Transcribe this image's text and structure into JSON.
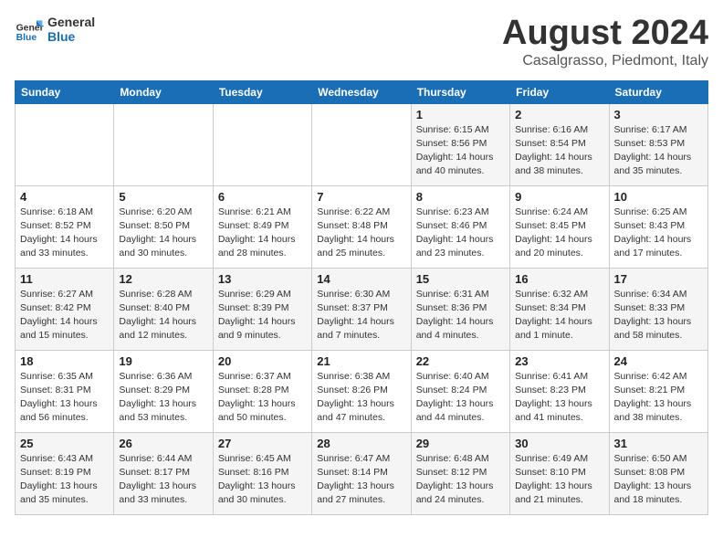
{
  "logo": {
    "line1": "General",
    "line2": "Blue"
  },
  "title": "August 2024",
  "subtitle": "Casalgrasso, Piedmont, Italy",
  "days_of_week": [
    "Sunday",
    "Monday",
    "Tuesday",
    "Wednesday",
    "Thursday",
    "Friday",
    "Saturday"
  ],
  "weeks": [
    [
      {
        "day": "",
        "info": ""
      },
      {
        "day": "",
        "info": ""
      },
      {
        "day": "",
        "info": ""
      },
      {
        "day": "",
        "info": ""
      },
      {
        "day": "1",
        "info": "Sunrise: 6:15 AM\nSunset: 8:56 PM\nDaylight: 14 hours\nand 40 minutes."
      },
      {
        "day": "2",
        "info": "Sunrise: 6:16 AM\nSunset: 8:54 PM\nDaylight: 14 hours\nand 38 minutes."
      },
      {
        "day": "3",
        "info": "Sunrise: 6:17 AM\nSunset: 8:53 PM\nDaylight: 14 hours\nand 35 minutes."
      }
    ],
    [
      {
        "day": "4",
        "info": "Sunrise: 6:18 AM\nSunset: 8:52 PM\nDaylight: 14 hours\nand 33 minutes."
      },
      {
        "day": "5",
        "info": "Sunrise: 6:20 AM\nSunset: 8:50 PM\nDaylight: 14 hours\nand 30 minutes."
      },
      {
        "day": "6",
        "info": "Sunrise: 6:21 AM\nSunset: 8:49 PM\nDaylight: 14 hours\nand 28 minutes."
      },
      {
        "day": "7",
        "info": "Sunrise: 6:22 AM\nSunset: 8:48 PM\nDaylight: 14 hours\nand 25 minutes."
      },
      {
        "day": "8",
        "info": "Sunrise: 6:23 AM\nSunset: 8:46 PM\nDaylight: 14 hours\nand 23 minutes."
      },
      {
        "day": "9",
        "info": "Sunrise: 6:24 AM\nSunset: 8:45 PM\nDaylight: 14 hours\nand 20 minutes."
      },
      {
        "day": "10",
        "info": "Sunrise: 6:25 AM\nSunset: 8:43 PM\nDaylight: 14 hours\nand 17 minutes."
      }
    ],
    [
      {
        "day": "11",
        "info": "Sunrise: 6:27 AM\nSunset: 8:42 PM\nDaylight: 14 hours\nand 15 minutes."
      },
      {
        "day": "12",
        "info": "Sunrise: 6:28 AM\nSunset: 8:40 PM\nDaylight: 14 hours\nand 12 minutes."
      },
      {
        "day": "13",
        "info": "Sunrise: 6:29 AM\nSunset: 8:39 PM\nDaylight: 14 hours\nand 9 minutes."
      },
      {
        "day": "14",
        "info": "Sunrise: 6:30 AM\nSunset: 8:37 PM\nDaylight: 14 hours\nand 7 minutes."
      },
      {
        "day": "15",
        "info": "Sunrise: 6:31 AM\nSunset: 8:36 PM\nDaylight: 14 hours\nand 4 minutes."
      },
      {
        "day": "16",
        "info": "Sunrise: 6:32 AM\nSunset: 8:34 PM\nDaylight: 14 hours\nand 1 minute."
      },
      {
        "day": "17",
        "info": "Sunrise: 6:34 AM\nSunset: 8:33 PM\nDaylight: 13 hours\nand 58 minutes."
      }
    ],
    [
      {
        "day": "18",
        "info": "Sunrise: 6:35 AM\nSunset: 8:31 PM\nDaylight: 13 hours\nand 56 minutes."
      },
      {
        "day": "19",
        "info": "Sunrise: 6:36 AM\nSunset: 8:29 PM\nDaylight: 13 hours\nand 53 minutes."
      },
      {
        "day": "20",
        "info": "Sunrise: 6:37 AM\nSunset: 8:28 PM\nDaylight: 13 hours\nand 50 minutes."
      },
      {
        "day": "21",
        "info": "Sunrise: 6:38 AM\nSunset: 8:26 PM\nDaylight: 13 hours\nand 47 minutes."
      },
      {
        "day": "22",
        "info": "Sunrise: 6:40 AM\nSunset: 8:24 PM\nDaylight: 13 hours\nand 44 minutes."
      },
      {
        "day": "23",
        "info": "Sunrise: 6:41 AM\nSunset: 8:23 PM\nDaylight: 13 hours\nand 41 minutes."
      },
      {
        "day": "24",
        "info": "Sunrise: 6:42 AM\nSunset: 8:21 PM\nDaylight: 13 hours\nand 38 minutes."
      }
    ],
    [
      {
        "day": "25",
        "info": "Sunrise: 6:43 AM\nSunset: 8:19 PM\nDaylight: 13 hours\nand 35 minutes."
      },
      {
        "day": "26",
        "info": "Sunrise: 6:44 AM\nSunset: 8:17 PM\nDaylight: 13 hours\nand 33 minutes."
      },
      {
        "day": "27",
        "info": "Sunrise: 6:45 AM\nSunset: 8:16 PM\nDaylight: 13 hours\nand 30 minutes."
      },
      {
        "day": "28",
        "info": "Sunrise: 6:47 AM\nSunset: 8:14 PM\nDaylight: 13 hours\nand 27 minutes."
      },
      {
        "day": "29",
        "info": "Sunrise: 6:48 AM\nSunset: 8:12 PM\nDaylight: 13 hours\nand 24 minutes."
      },
      {
        "day": "30",
        "info": "Sunrise: 6:49 AM\nSunset: 8:10 PM\nDaylight: 13 hours\nand 21 minutes."
      },
      {
        "day": "31",
        "info": "Sunrise: 6:50 AM\nSunset: 8:08 PM\nDaylight: 13 hours\nand 18 minutes."
      }
    ]
  ]
}
